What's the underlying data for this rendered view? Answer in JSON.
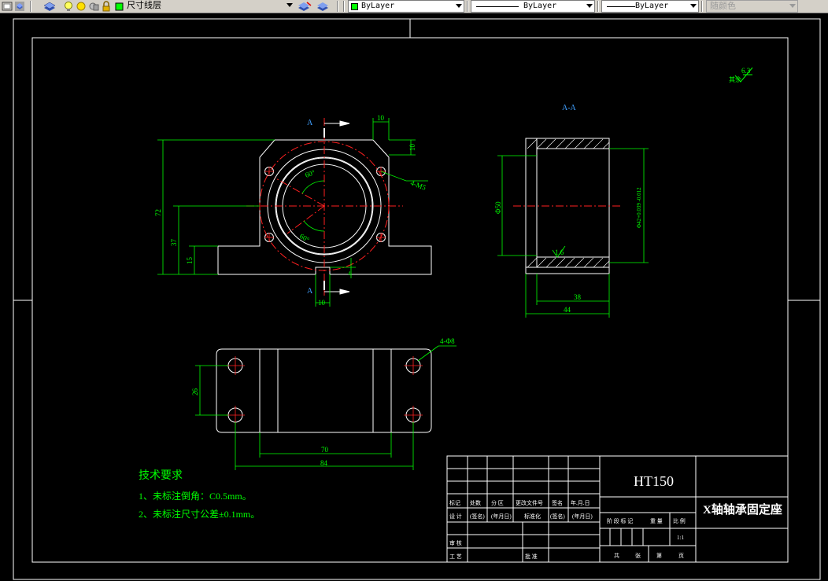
{
  "toolbar": {
    "layer_name": "尺寸线层",
    "color_label": "ByLayer",
    "linetype_label": "ByLayer",
    "lineweight_label": "ByLayer",
    "plotstyle_label": "随颜色"
  },
  "drawing": {
    "roughness_note": "其余",
    "roughness_value": "6.3",
    "section_label": "A-A",
    "cut_label_top": "A",
    "cut_label_bottom": "A",
    "front_dims": {
      "d10_top": "10",
      "d10_side": "10",
      "angle_top": "60°",
      "angle_bottom": "60°",
      "holes": "4-M5",
      "d72": "72",
      "d37": "37",
      "d15": "15",
      "d4": "4",
      "d10_bottom": "10"
    },
    "section_dims": {
      "d50": "Φ50",
      "bore": "Φ42+0.039 -0.012",
      "roughness": "1.6",
      "d38": "38",
      "d44": "44"
    },
    "top_dims": {
      "holes": "4-Φ8",
      "d26": "26",
      "d70": "70",
      "d84": "84"
    },
    "tech_title": "技术要求",
    "tech_notes": [
      "1、未标注倒角：C0.5mm。",
      "2、未标注尺寸公差±0.1mm。"
    ]
  },
  "title_block": {
    "material": "HT150",
    "part_name": "X轴轴承固定座",
    "scale": "1:1",
    "row_labels": [
      "标记",
      "处数",
      "分 区",
      "更改文件号",
      "签名",
      "年.月.日"
    ],
    "design_row": [
      "设 计",
      "(签名)",
      "(年月日)",
      "标准化",
      "(签名)",
      "(年月日)"
    ],
    "stage_headers": [
      "阶 段 标 记",
      "重 量",
      "比 例"
    ],
    "review": "审 核",
    "process": "工 艺",
    "approve": "批 准",
    "sheet_row": [
      "共",
      "张",
      "第",
      "页"
    ]
  }
}
